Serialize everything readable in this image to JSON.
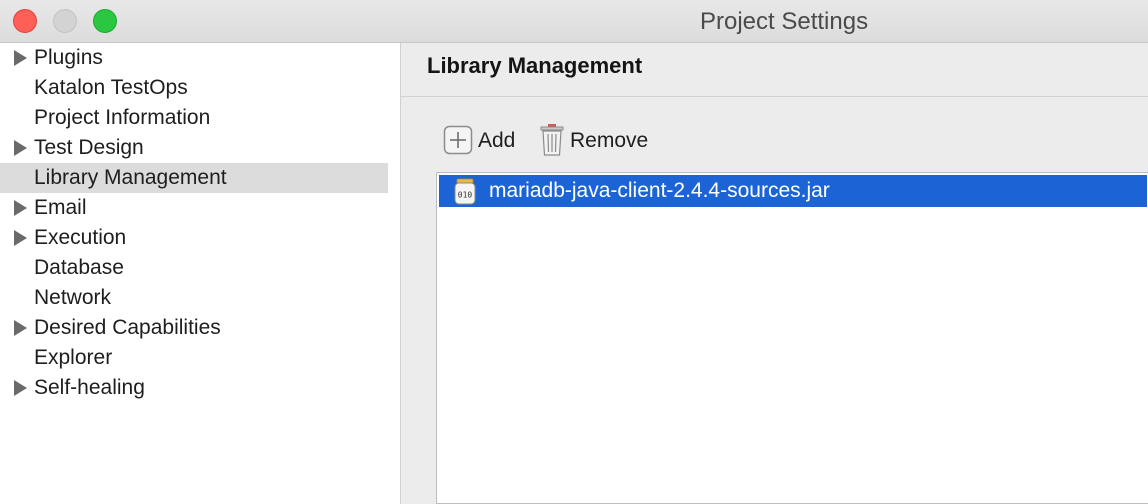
{
  "window": {
    "title": "Project Settings"
  },
  "sidebar": {
    "items": [
      {
        "label": "Plugins",
        "expandable": true,
        "selected": false
      },
      {
        "label": "Katalon TestOps",
        "expandable": false,
        "selected": false
      },
      {
        "label": "Project Information",
        "expandable": false,
        "selected": false
      },
      {
        "label": "Test Design",
        "expandable": true,
        "selected": false
      },
      {
        "label": "Library Management",
        "expandable": false,
        "selected": true
      },
      {
        "label": "Email",
        "expandable": true,
        "selected": false
      },
      {
        "label": "Execution",
        "expandable": true,
        "selected": false
      },
      {
        "label": "Database",
        "expandable": false,
        "selected": false
      },
      {
        "label": "Network",
        "expandable": false,
        "selected": false
      },
      {
        "label": "Desired Capabilities",
        "expandable": true,
        "selected": false
      },
      {
        "label": "Explorer",
        "expandable": false,
        "selected": false
      },
      {
        "label": "Self-healing",
        "expandable": true,
        "selected": false
      }
    ]
  },
  "main": {
    "title": "Library Management",
    "toolbar": {
      "add_label": "Add",
      "remove_label": "Remove"
    },
    "libraries": [
      {
        "name": "mariadb-java-client-2.4.4-sources.jar",
        "icon": "jar-file-icon",
        "selected": true
      }
    ]
  },
  "colors": {
    "selection": "#1c64d6",
    "sidebar_selection": "#dcdcdc",
    "close": "#fe5f57",
    "zoom": "#29c840"
  }
}
